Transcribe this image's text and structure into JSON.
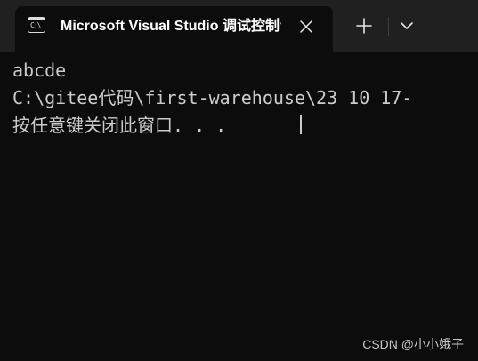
{
  "window": {
    "tab": {
      "icon": "console-app-icon",
      "icon_glyph": "C:\\",
      "title": "Microsoft Visual Studio 调试控制台",
      "close_icon": "close-icon"
    },
    "new_tab_icon": "plus-icon",
    "dropdown_icon": "chevron-down-icon"
  },
  "console": {
    "lines": [
      "abcde",
      "C:\\gitee代码\\first-warehouse\\23_10_17-",
      "按任意键关闭此窗口. . ."
    ]
  },
  "watermark": {
    "text": "CSDN @小小娥子"
  },
  "colors": {
    "titlebar": "#202020",
    "console_background": "#0c0c0c",
    "console_text": "#cccccc"
  }
}
